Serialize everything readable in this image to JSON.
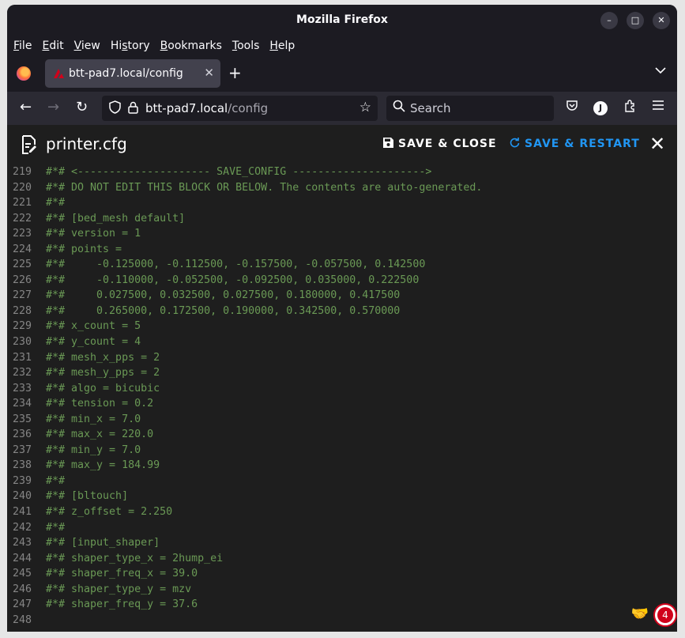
{
  "window": {
    "title": "Mozilla Firefox",
    "minimize": "–",
    "maximize": "□",
    "close": "✕"
  },
  "menu": [
    {
      "pre": "",
      "u": "F",
      "post": "ile"
    },
    {
      "pre": "",
      "u": "E",
      "post": "dit"
    },
    {
      "pre": "",
      "u": "V",
      "post": "iew"
    },
    {
      "pre": "Hi",
      "u": "s",
      "post": "tory"
    },
    {
      "pre": "",
      "u": "B",
      "post": "ookmarks"
    },
    {
      "pre": "",
      "u": "T",
      "post": "ools"
    },
    {
      "pre": "",
      "u": "H",
      "post": "elp"
    }
  ],
  "tab": {
    "label": "btt-pad7.local/config",
    "close": "✕",
    "new": "+",
    "list": "⌄"
  },
  "nav": {
    "back": "←",
    "forward": "→",
    "reload": "↻",
    "host": "btt-pad7.local",
    "path": "/config",
    "star": "☆",
    "search_placeholder": "Search"
  },
  "app": {
    "file_name": "printer.cfg",
    "save_close": "SAVE & CLOSE",
    "save_restart": "SAVE & RESTART",
    "close": "✕"
  },
  "editor": {
    "lines": [
      {
        "n": "219",
        "t": "#*# <--------------------- SAVE_CONFIG --------------------->"
      },
      {
        "n": "220",
        "t": "#*# DO NOT EDIT THIS BLOCK OR BELOW. The contents are auto-generated."
      },
      {
        "n": "221",
        "t": "#*#"
      },
      {
        "n": "222",
        "t": "#*# [bed_mesh default]"
      },
      {
        "n": "223",
        "t": "#*# version = 1"
      },
      {
        "n": "224",
        "t": "#*# points ="
      },
      {
        "n": "225",
        "t": "#*#     -0.125000, -0.112500, -0.157500, -0.057500, 0.142500"
      },
      {
        "n": "226",
        "t": "#*#     -0.110000, -0.052500, -0.092500, 0.035000, 0.222500"
      },
      {
        "n": "227",
        "t": "#*#     0.027500, 0.032500, 0.027500, 0.180000, 0.417500"
      },
      {
        "n": "228",
        "t": "#*#     0.265000, 0.172500, 0.190000, 0.342500, 0.570000"
      },
      {
        "n": "229",
        "t": "#*# x_count = 5"
      },
      {
        "n": "230",
        "t": "#*# y_count = 4"
      },
      {
        "n": "231",
        "t": "#*# mesh_x_pps = 2"
      },
      {
        "n": "232",
        "t": "#*# mesh_y_pps = 2"
      },
      {
        "n": "233",
        "t": "#*# algo = bicubic"
      },
      {
        "n": "234",
        "t": "#*# tension = 0.2"
      },
      {
        "n": "235",
        "t": "#*# min_x = 7.0"
      },
      {
        "n": "236",
        "t": "#*# max_x = 220.0"
      },
      {
        "n": "237",
        "t": "#*# min_y = 7.0"
      },
      {
        "n": "238",
        "t": "#*# max_y = 184.99"
      },
      {
        "n": "239",
        "t": "#*#"
      },
      {
        "n": "240",
        "t": "#*# [bltouch]"
      },
      {
        "n": "241",
        "t": "#*# z_offset = 2.250"
      },
      {
        "n": "242",
        "t": "#*#"
      },
      {
        "n": "243",
        "t": "#*# [input_shaper]"
      },
      {
        "n": "244",
        "t": "#*# shaper_type_x = 2hump_ei"
      },
      {
        "n": "245",
        "t": "#*# shaper_freq_x = 39.0"
      },
      {
        "n": "246",
        "t": "#*# shaper_type_y = mzv"
      },
      {
        "n": "247",
        "t": "#*# shaper_freq_y = 37.6"
      },
      {
        "n": "248",
        "t": ""
      }
    ]
  },
  "notification": {
    "count": "4"
  },
  "icons": {
    "shield": "shield-icon",
    "lock": "lock-icon",
    "pocket": "pocket-icon",
    "extensions": "extensions-icon",
    "menu": "hamburger-icon",
    "avatar": "J"
  },
  "colors": {
    "comment": "#6a9955",
    "accent": "#2196f3",
    "badge": "#d0021b"
  }
}
